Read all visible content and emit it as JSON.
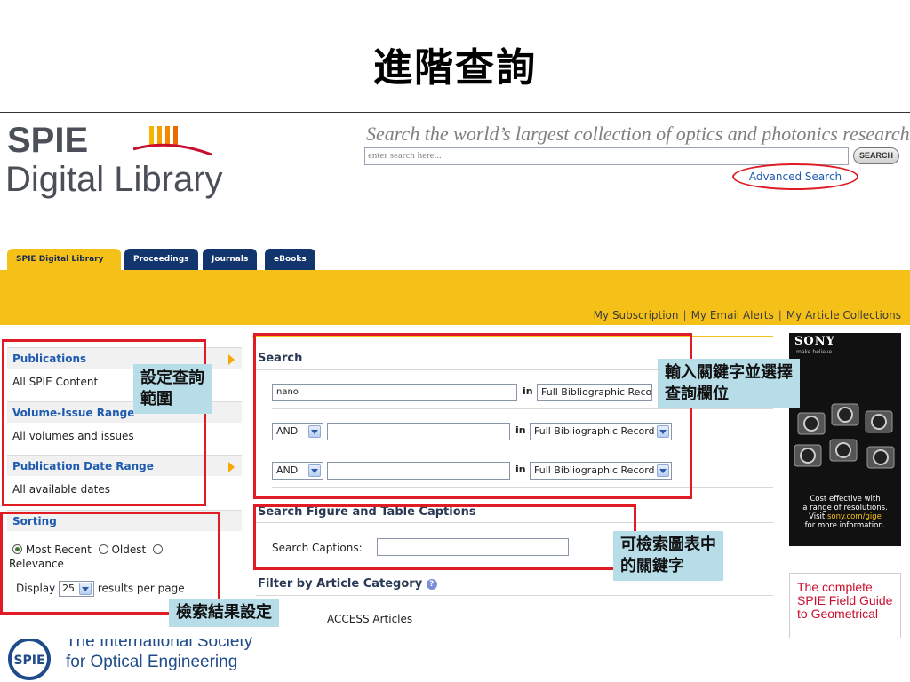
{
  "slide": {
    "title": "進階查詢"
  },
  "logo": {
    "line1": "SPIE",
    "line2": "Digital Library"
  },
  "header": {
    "tagline": "Search the world’s largest collection of optics and photonics research.",
    "search_placeholder": "enter search here...",
    "search_button": "SEARCH",
    "advanced_search": "Advanced Search"
  },
  "tabs": [
    {
      "label": "SPIE Digital Library",
      "active": true
    },
    {
      "label": "Proceedings",
      "active": false
    },
    {
      "label": "Journals",
      "active": false
    },
    {
      "label": "eBooks",
      "active": false
    }
  ],
  "user_links": [
    "My Subscription",
    "My Email Alerts",
    "My Article Collections"
  ],
  "left_panel": {
    "publications": {
      "heading": "Publications",
      "value": "All SPIE Content"
    },
    "volume": {
      "heading": "Volume-Issue Range",
      "value": "All volumes and issues"
    },
    "date": {
      "heading": "Publication Date Range",
      "value": "All available dates"
    },
    "sorting": {
      "heading": "Sorting",
      "options": [
        "Most Recent",
        "Oldest",
        "Relevance"
      ],
      "selected": "Most Recent",
      "display_prefix": "Display",
      "display_value": "25",
      "display_suffix": "results per page"
    }
  },
  "search_form": {
    "heading": "Search",
    "in_label": "in",
    "rows": [
      {
        "operator": "",
        "term": "nano",
        "field": "Full Bibliographic Record"
      },
      {
        "operator": "AND",
        "term": "",
        "field": "Full Bibliographic Record"
      },
      {
        "operator": "AND",
        "term": "",
        "field": "Full Bibliographic Record"
      }
    ],
    "captions_heading": "Search Figure and Table Captions",
    "captions_label": "Search Captions:",
    "captions_value": "",
    "filter_heading": "Filter by Article Category",
    "filter_item_visible": "ACCESS Articles"
  },
  "callouts": {
    "scope": "設定查詢\n範圍",
    "keywords": "輸入關鍵字並選擇\n查詢欄位",
    "captions": "可檢索圖表中\n的關鍵字",
    "results": "檢索結果設定"
  },
  "ads": {
    "sony_brand": "SONY",
    "sony_slogan": "make.believe",
    "sony_text1": "Cost effective with",
    "sony_text2": "a range of resolutions.",
    "sony_text3_prefix": "Visit ",
    "sony_link": "sony.com/gige",
    "sony_text4": "for more information.",
    "field_guide": "The complete SPIE Field Guide to Geometrical"
  },
  "footer": {
    "line1": "The International Society",
    "line2": "for Optical Engineering"
  },
  "colors": {
    "brand_yellow": "#f5c118",
    "tab_navy": "#12356e",
    "highlight_red": "#e01b24",
    "callout_blue": "#b7dde8",
    "link_blue": "#1f5bb0"
  }
}
